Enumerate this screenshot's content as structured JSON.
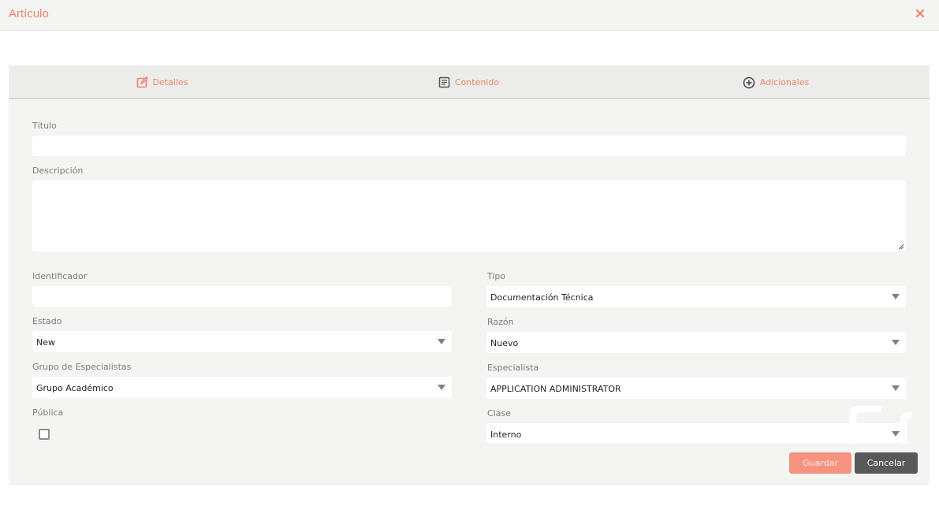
{
  "modal": {
    "title": "Artículo",
    "close_icon": "close-icon"
  },
  "tabs": [
    {
      "label": "Detalles",
      "icon": "edit-icon",
      "active": true
    },
    {
      "label": "Contenido",
      "icon": "document-icon",
      "active": false
    },
    {
      "label": "Adicionales",
      "icon": "plus-circle-icon",
      "active": false
    }
  ],
  "form": {
    "titulo": {
      "label": "Título",
      "value": ""
    },
    "descripcion": {
      "label": "Descripción",
      "value": ""
    },
    "identificador": {
      "label": "Identificador",
      "value": ""
    },
    "tipo": {
      "label": "Tipo",
      "value": "Documentación Técnica"
    },
    "estado": {
      "label": "Estado",
      "value": "New"
    },
    "razon": {
      "label": "Razón",
      "value": "Nuevo"
    },
    "grupo": {
      "label": "Grupo de Especialistas",
      "value": "Grupo Académico"
    },
    "especialista": {
      "label": "Especialista",
      "value": "APPLICATION ADMINISTRATOR"
    },
    "publica": {
      "label": "Pública",
      "checked": false
    },
    "clase": {
      "label": "Clase",
      "value": "Interno"
    }
  },
  "actions": {
    "save_label": "Guardar",
    "cancel_label": "Cancelar"
  },
  "colors": {
    "accent": "#f0826e",
    "save_button": "#f59280",
    "cancel_button": "#58595a",
    "panel_bg": "#f4f4f2"
  }
}
